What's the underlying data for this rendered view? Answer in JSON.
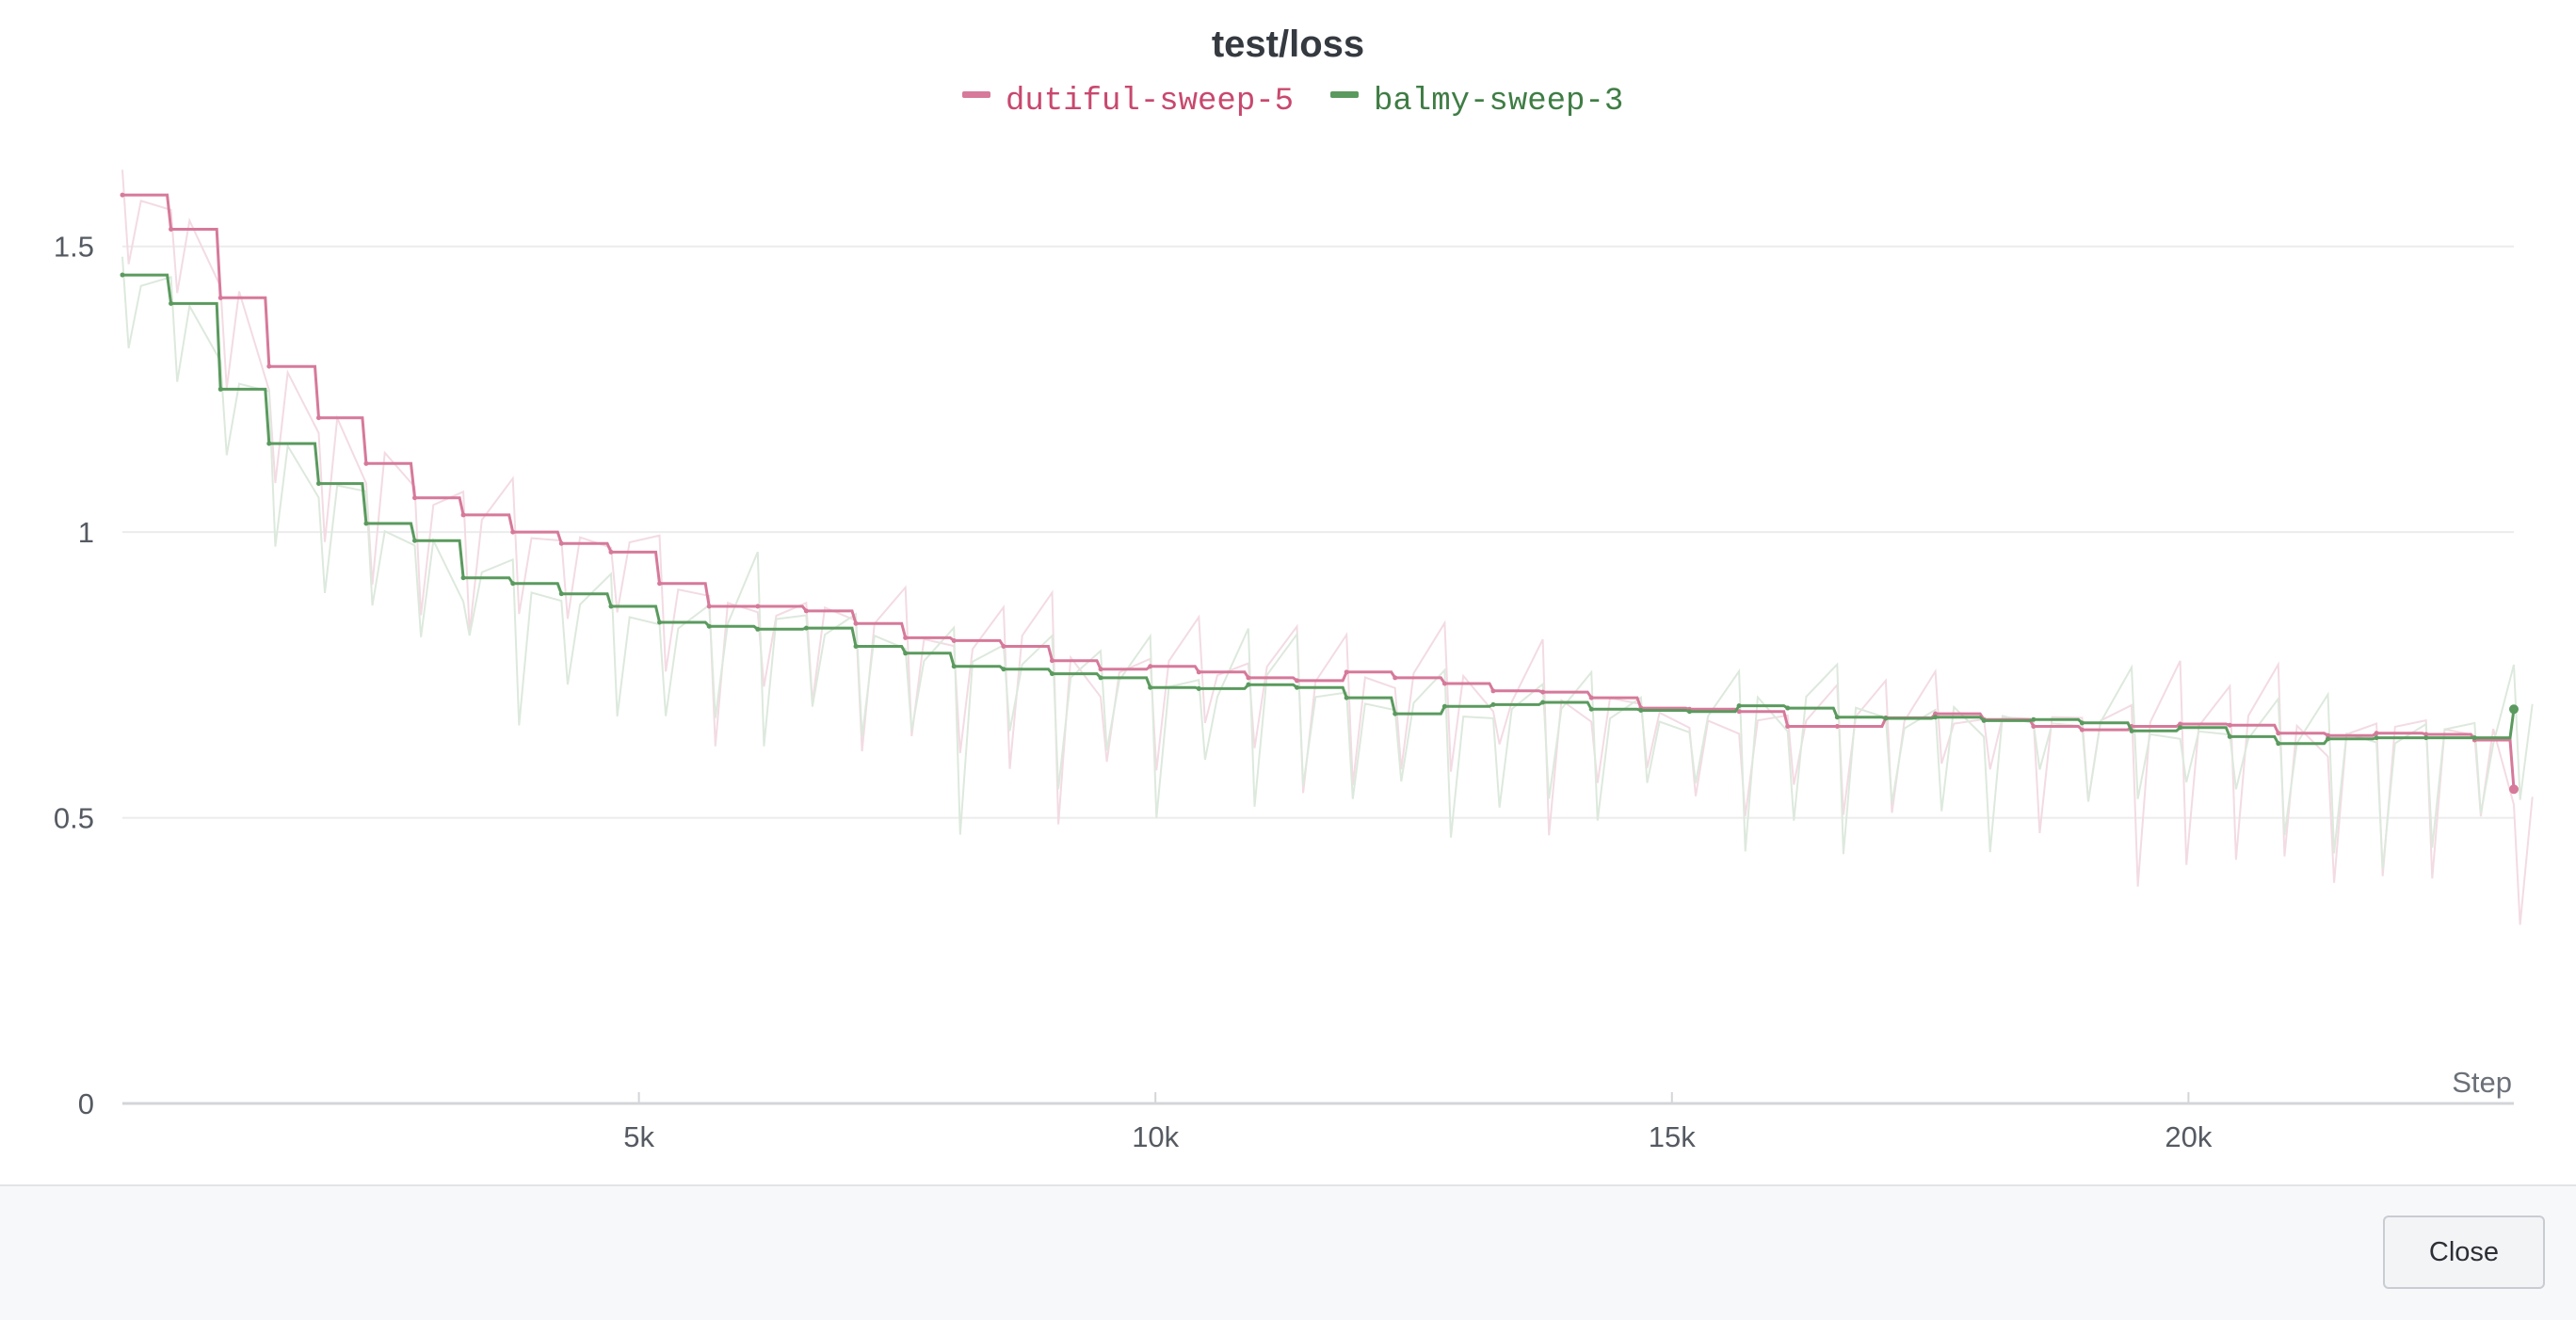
{
  "chart_data": {
    "type": "line",
    "title": "test/loss",
    "xlabel": "Step",
    "ylabel": "",
    "xlim": [
      0,
      23150
    ],
    "ylim": [
      0,
      1.75
    ],
    "x_ticks": [
      5000,
      10000,
      15000,
      20000
    ],
    "x_tick_labels": [
      "5k",
      "10k",
      "15k",
      "20k"
    ],
    "y_ticks": [
      0,
      0.5,
      1,
      1.5
    ],
    "y_tick_labels": [
      "0",
      "0.5",
      "1",
      "1.5"
    ],
    "grid": true,
    "legend_position": "top-center",
    "series": [
      {
        "name": "dutiful-sweep-5",
        "color": "#d6799a",
        "x": [
          0,
          470,
          950,
          1420,
          1900,
          2360,
          2830,
          3300,
          3780,
          4250,
          4730,
          5200,
          5680,
          6150,
          6620,
          7100,
          7580,
          8050,
          8530,
          9000,
          9470,
          9950,
          10420,
          10900,
          11370,
          11850,
          12320,
          12800,
          13270,
          13750,
          14220,
          14700,
          15170,
          15650,
          16120,
          16600,
          17070,
          17550,
          18020,
          18500,
          18970,
          19450,
          19920,
          20400,
          20870,
          21350,
          21820,
          22300,
          22770,
          23150
        ],
        "values": [
          1.59,
          1.53,
          1.41,
          1.29,
          1.2,
          1.12,
          1.06,
          1.03,
          1.0,
          0.98,
          0.965,
          0.91,
          0.87,
          0.87,
          0.862,
          0.84,
          0.815,
          0.81,
          0.8,
          0.775,
          0.76,
          0.765,
          0.755,
          0.745,
          0.74,
          0.755,
          0.745,
          0.735,
          0.722,
          0.72,
          0.71,
          0.692,
          0.69,
          0.686,
          0.66,
          0.66,
          0.675,
          0.682,
          0.672,
          0.66,
          0.654,
          0.66,
          0.664,
          0.662,
          0.648,
          0.644,
          0.648,
          0.646,
          0.636,
          0.55
        ]
      },
      {
        "name": "balmy-sweep-3",
        "color": "#5a9a5e",
        "x": [
          0,
          470,
          950,
          1420,
          1900,
          2360,
          2830,
          3300,
          3780,
          4250,
          4730,
          5200,
          5680,
          6150,
          6620,
          7100,
          7580,
          8050,
          8530,
          9000,
          9470,
          9950,
          10420,
          10900,
          11370,
          11850,
          12320,
          12800,
          13270,
          13750,
          14220,
          14700,
          15170,
          15650,
          16120,
          16600,
          17070,
          17550,
          18020,
          18500,
          18970,
          19450,
          19920,
          20400,
          20870,
          21350,
          21820,
          22300,
          22770,
          23150
        ],
        "values": [
          1.45,
          1.4,
          1.25,
          1.155,
          1.085,
          1.015,
          0.985,
          0.92,
          0.91,
          0.892,
          0.87,
          0.842,
          0.835,
          0.83,
          0.832,
          0.8,
          0.788,
          0.765,
          0.76,
          0.752,
          0.745,
          0.728,
          0.726,
          0.733,
          0.728,
          0.71,
          0.682,
          0.695,
          0.698,
          0.702,
          0.69,
          0.688,
          0.686,
          0.696,
          0.692,
          0.676,
          0.674,
          0.676,
          0.67,
          0.672,
          0.666,
          0.652,
          0.658,
          0.642,
          0.63,
          0.638,
          0.64,
          0.64,
          0.64,
          0.69
        ]
      }
    ]
  },
  "footer": {
    "close_label": "Close"
  }
}
